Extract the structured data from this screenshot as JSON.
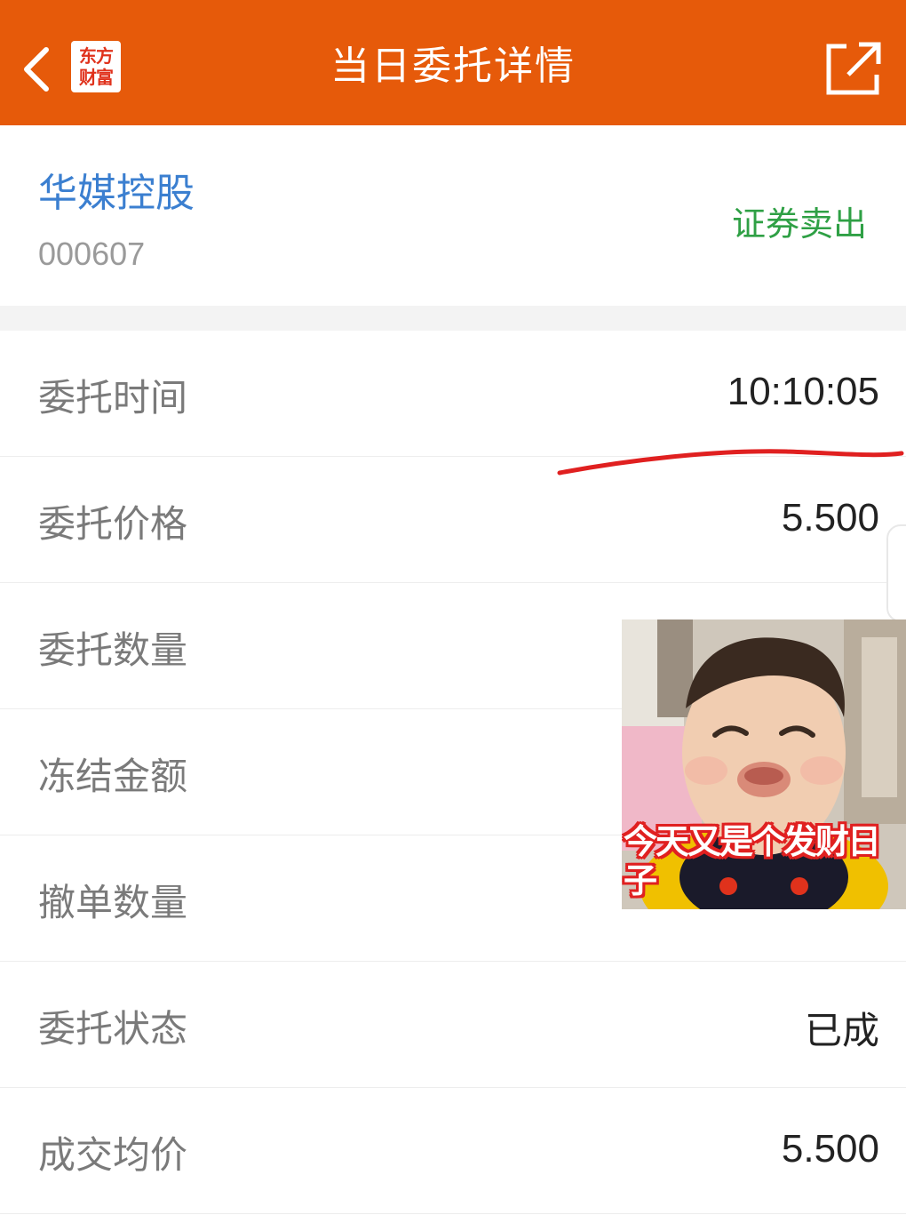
{
  "header": {
    "title": "当日委托详情",
    "logo_line1": "东方",
    "logo_line2": "财富"
  },
  "stock": {
    "name": "华媒控股",
    "code": "000607",
    "trade_type": "证券卖出"
  },
  "details": [
    {
      "label": "委托时间",
      "value": "10:10:05"
    },
    {
      "label": "委托价格",
      "value": "5.500"
    },
    {
      "label": "委托数量",
      "value": ""
    },
    {
      "label": "冻结金额",
      "value": ""
    },
    {
      "label": "撤单数量",
      "value": ""
    },
    {
      "label": "委托状态",
      "value": "已成"
    },
    {
      "label": "成交均价",
      "value": "5.500"
    }
  ],
  "meme": {
    "caption": "今天又是个发财日子"
  },
  "colors": {
    "header_bg": "#e65a0a",
    "stock_name": "#3b7fd0",
    "trade_type": "#2fa045",
    "annotation_line": "#e02020"
  }
}
